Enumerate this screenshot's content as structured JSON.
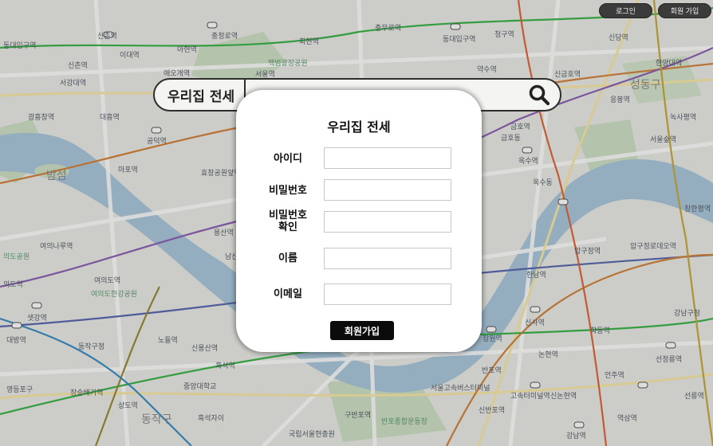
{
  "header": {
    "login_label": "로그인",
    "signup_label": "회원 가입"
  },
  "search": {
    "title": "우리집 전세",
    "placeholder": "",
    "icon": "search-icon"
  },
  "modal": {
    "title": "우리집 전세",
    "fields": [
      {
        "label": "아이디",
        "value": ""
      },
      {
        "label": "비밀번호",
        "value": ""
      },
      {
        "label": "비밀번호\n확인",
        "value": ""
      },
      {
        "label": "이름",
        "value": ""
      },
      {
        "label": "이메일",
        "value": ""
      }
    ],
    "submit_label": "회원가입"
  },
  "map": {
    "labels": [
      "동대입구역",
      "신촌역",
      "이대역",
      "충정로역",
      "서울역",
      "백범광장공원",
      "동대입구역",
      "충무로역",
      "청구역",
      "신금호역",
      "한양대역",
      "신촌역",
      "아현역",
      "서강대역",
      "회현역",
      "약수역",
      "신당역",
      "성동구",
      "광흥창역",
      "대흥역",
      "공덕역",
      "금호역",
      "옥수역",
      "응봉역",
      "서울숲역",
      "애오개역",
      "효창공원앞역",
      "밤섬",
      "마포역",
      "남산",
      "여의나루역",
      "여의도역",
      "여의도한강공원",
      "용산역",
      "한남역",
      "압구정역",
      "압구정로데오역",
      "신용산역",
      "노들역",
      "동작구정",
      "흑석역",
      "대방역",
      "샛강역",
      "영등포구",
      "중앙대학교",
      "상도역",
      "동작구",
      "흑석자이",
      "구반포역",
      "반포역",
      "신사역",
      "학동역",
      "강남구청",
      "논현역",
      "선정릉역",
      "언주역",
      "신논현역",
      "선릉역",
      "역삼역",
      "강남역",
      "국립서울현충원",
      "반포종합운동장",
      "서울고속버스터미널",
      "잠원역",
      "고속터미널역",
      "신반포역",
      "장승배기역",
      "의도역",
      "의도공원",
      "녹사평역",
      "장한평역",
      "금호동",
      "옥수동"
    ]
  }
}
